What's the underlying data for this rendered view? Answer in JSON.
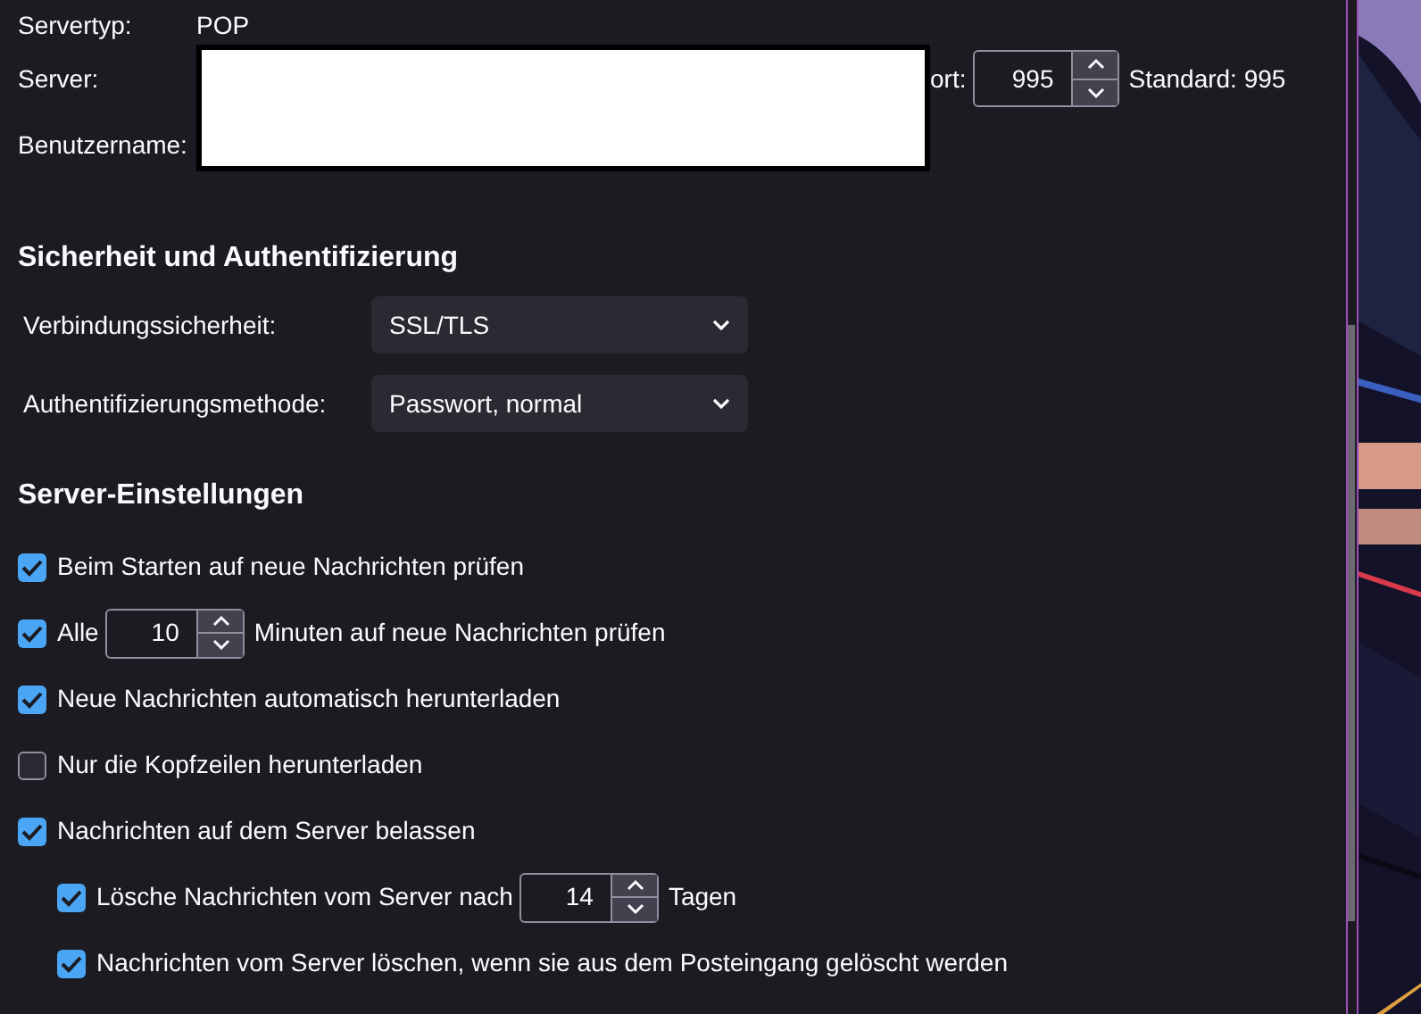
{
  "account": {
    "server_type_label": "Servertyp:",
    "server_type": "POP",
    "server_label": "Server:",
    "username_label": "Benutzername:",
    "port_label": "ort:",
    "port": "995",
    "port_default": "Standard: 995"
  },
  "security": {
    "heading": "Sicherheit und Authentifizierung",
    "fields": [
      {
        "label": "Verbindungssicherheit:",
        "value": "SSL/TLS"
      },
      {
        "label": "Authentifizierungsmethode:",
        "value": "Passwort, normal"
      }
    ]
  },
  "server_settings": {
    "heading": "Server-Einstellungen",
    "options": [
      {
        "kind": "checkbox",
        "label": "Beim Starten auf neue Nachrichten prüfen",
        "checked": true
      },
      {
        "kind": "spin",
        "label": "Alle",
        "value": "10",
        "suffix": "Minuten auf neue Nachrichten prüfen",
        "checked": true
      },
      {
        "kind": "checkbox",
        "label": "Neue Nachrichten automatisch herunterladen",
        "checked": true
      },
      {
        "kind": "checkbox",
        "label": "Nur die Kopfzeilen herunterladen",
        "checked": false
      },
      {
        "kind": "checkbox",
        "label": "Nachrichten auf dem Server belassen",
        "checked": true,
        "children": [
          {
            "kind": "spin",
            "label": "Lösche Nachrichten vom Server nach",
            "value": "14",
            "suffix": "Tagen",
            "checked": true
          },
          {
            "kind": "checkbox",
            "label": "Nachrichten vom Server löschen, wenn sie aus dem Posteingang gelöscht werden",
            "checked": true
          }
        ]
      }
    ]
  }
}
